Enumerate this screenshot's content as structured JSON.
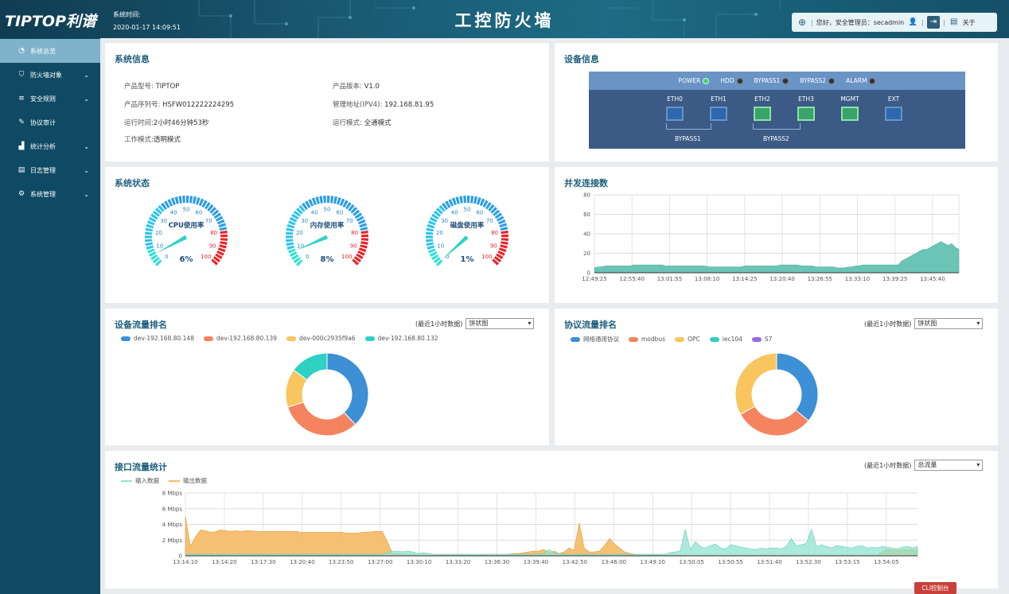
{
  "header": {
    "logo": "TIPTOP利谱",
    "systime_label": "系统时间:",
    "systime": "2020-01-17 14:09:51",
    "title": "工控防火墙",
    "greeting": "您好，安全管理员：secadmin",
    "about": "关于"
  },
  "sidebar": {
    "items": [
      {
        "label": "系统总览",
        "icon": "dashboard-icon",
        "active": true,
        "chevron": false
      },
      {
        "label": "防火墙对象",
        "icon": "shield-icon",
        "active": false,
        "chevron": true
      },
      {
        "label": "安全规则",
        "icon": "list-icon",
        "active": false,
        "chevron": true
      },
      {
        "label": "协议审计",
        "icon": "wrench-icon",
        "active": false,
        "chevron": false
      },
      {
        "label": "统计分析",
        "icon": "chart-icon",
        "active": false,
        "chevron": true
      },
      {
        "label": "日志管理",
        "icon": "book-icon",
        "active": false,
        "chevron": true
      },
      {
        "label": "系统管理",
        "icon": "gears-icon",
        "active": false,
        "chevron": true
      }
    ]
  },
  "system_info": {
    "title": "系统信息",
    "model_k": "产品型号:",
    "model_v": "TIPTOP",
    "version_k": "产品版本:",
    "version_v": "V1.0",
    "serial_k": "产品序列号:",
    "serial_v": "HSFW012222224295",
    "mgmt_k": "管理地址(IPV4):",
    "mgmt_v": "192.168.81.95",
    "uptime_k": "运行时间:",
    "uptime_v": "2小时46分钟53秒",
    "runmode_k": "运行模式:",
    "runmode_v": "全通模式",
    "workmode_k": "工作模式:",
    "workmode_v": "透明模式"
  },
  "device_info": {
    "title": "设备信息",
    "leds": [
      {
        "label": "POWER",
        "on": true
      },
      {
        "label": "HDD",
        "on": false
      },
      {
        "label": "BYPASS1",
        "on": false
      },
      {
        "label": "BYPASS2",
        "on": false
      },
      {
        "label": "ALARM",
        "on": false
      }
    ],
    "ports": [
      {
        "label": "ETH0",
        "up": false
      },
      {
        "label": "ETH1",
        "up": false
      },
      {
        "label": "ETH2",
        "up": true
      },
      {
        "label": "ETH3",
        "up": true
      },
      {
        "label": "MGMT",
        "up": true
      },
      {
        "label": "EXT",
        "up": false
      }
    ],
    "bypass1": "BYPASS1",
    "bypass2": "BYPASS2"
  },
  "system_status": {
    "title": "系统状态",
    "ticks": [
      "0",
      "10",
      "20",
      "30",
      "40",
      "50",
      "60",
      "70",
      "80",
      "90",
      "100"
    ],
    "gauges": [
      {
        "label": "CPU使用率",
        "value": 6,
        "text": "6%"
      },
      {
        "label": "内存使用率",
        "value": 8,
        "text": "8%"
      },
      {
        "label": "磁盘使用率",
        "value": 1,
        "text": "1%"
      }
    ]
  },
  "concurrent": {
    "title": "并发连接数",
    "chart_data": {
      "type": "area",
      "ylim": [
        0,
        80
      ],
      "yticks": [
        "0",
        "20",
        "40",
        "60",
        "80"
      ],
      "xticks": [
        "12:49:25",
        "12:55:40",
        "13:01:55",
        "13:08:10",
        "13:14:25",
        "13:20:40",
        "13:26:55",
        "13:33:10",
        "13:39:25",
        "13:45:40"
      ],
      "color": "#6cc4b6",
      "values": [
        5,
        6,
        6,
        7,
        7,
        7,
        7,
        7,
        7,
        7,
        7,
        8,
        8,
        8,
        8,
        8,
        8,
        8,
        8,
        8,
        7,
        7,
        7,
        7,
        7,
        7,
        7,
        7,
        7,
        7,
        7,
        7,
        6,
        6,
        6,
        6,
        6,
        6,
        6,
        6,
        6,
        6,
        7,
        7,
        7,
        7,
        7,
        7,
        7,
        7,
        7,
        7,
        8,
        8,
        8,
        8,
        8,
        8,
        7,
        7,
        7,
        7,
        6,
        6,
        6,
        6,
        6,
        6,
        5,
        5,
        5,
        6,
        6,
        7,
        7,
        8,
        8,
        8,
        8,
        8,
        8,
        8,
        8,
        8,
        8,
        8,
        12,
        14,
        16,
        18,
        20,
        22,
        24,
        24,
        26,
        28,
        30,
        32,
        30,
        28,
        30,
        26,
        24
      ]
    }
  },
  "device_traffic": {
    "title": "设备流量排名",
    "range": "(最近1小时数据)",
    "select": "饼状图",
    "chart_data": {
      "type": "pie",
      "series": [
        {
          "name": "dev-192.168.80.148",
          "value": 38,
          "color": "#3d8fd6"
        },
        {
          "name": "dev-192.168.80.139",
          "value": 32,
          "color": "#f4835f"
        },
        {
          "name": "dev-000c2935f9a6",
          "value": 15,
          "color": "#f8c55f"
        },
        {
          "name": "dev-192.168.80.132",
          "value": 15,
          "color": "#2fd1c3"
        }
      ]
    }
  },
  "protocol_traffic": {
    "title": "协议流量排名",
    "range": "(最近1小时数据)",
    "select": "饼状图",
    "chart_data": {
      "type": "pie",
      "series": [
        {
          "name": "网络通用协议",
          "value": 36,
          "color": "#3d8fd6"
        },
        {
          "name": "modbus",
          "value": 31,
          "color": "#f4835f"
        },
        {
          "name": "OPC",
          "value": 33,
          "color": "#f8c55f"
        },
        {
          "name": "iec104",
          "value": 0,
          "color": "#2fd1c3"
        },
        {
          "name": "S7",
          "value": 0,
          "color": "#9a6ae3"
        }
      ]
    }
  },
  "interface_traffic": {
    "title": "接口流量统计",
    "range": "(最近1小时数据)",
    "select": "总流量",
    "chart_data": {
      "type": "area",
      "ylim": [
        0,
        8
      ],
      "yticks": [
        "0",
        "2 Mbps",
        "4 Mbps",
        "6 Mbps",
        "8 Mbps"
      ],
      "xticks": [
        "13:14:10",
        "13:14:20",
        "13:17:30",
        "13:20:40",
        "13:23:50",
        "13:27:00",
        "13:30:10",
        "13:33:20",
        "13:36:30",
        "13:39:40",
        "13:42:50",
        "13:46:00",
        "13:49:10",
        "13:50:05",
        "13:50:55",
        "13:51:40",
        "13:52:30",
        "13:53:15",
        "13:54:05"
      ],
      "series": [
        {
          "name": "输入数据",
          "color": "#8fe3d0",
          "values": [
            0.2,
            0.2,
            0.2,
            0.2,
            0.2,
            0.2,
            0.2,
            0.2,
            0.2,
            0.2,
            0.2,
            0.2,
            0.2,
            0.2,
            0.2,
            0.2,
            0.2,
            0.2,
            0.2,
            0.2,
            0.2,
            0.2,
            0.2,
            0.2,
            0.2,
            0.2,
            0.2,
            0.2,
            0.2,
            0.2,
            0.2,
            0.2,
            0.2,
            0.2,
            0.2,
            0.2,
            0.2,
            0.2,
            0.2,
            0.2,
            0.4,
            0.6,
            0.6,
            0.5,
            0.6,
            0.5,
            0.3,
            0.4,
            0.3,
            0.2,
            0.2,
            0.2,
            0.2,
            0.2,
            0.2,
            0.2,
            0.2,
            0.2,
            0.2,
            0.2,
            0.2,
            0.2,
            0.2,
            0.2,
            0.2,
            0.2,
            0.2,
            0.2,
            0.2,
            0.2,
            0.2,
            0.3,
            0.8,
            0.4,
            0.3,
            0.2,
            0.2,
            0.2,
            0.2,
            0.2,
            0.2,
            0.2,
            0.2,
            0.2,
            0.2,
            0.2,
            0.2,
            0.2,
            0.2,
            0.2,
            0.2,
            0.2,
            0.2,
            0.2,
            0.2,
            0.2,
            0.4,
            0.5,
            0.6,
            3.4,
            0.8,
            1.8,
            1.2,
            1.0,
            1.3,
            1.5,
            1.0,
            0.9,
            1.4,
            1.3,
            1.1,
            1.0,
            0.9,
            0.8,
            1.0,
            0.9,
            1.0,
            1.0,
            0.9,
            1.2,
            2.2,
            1.3,
            1.4,
            1.6,
            3.4,
            1.2,
            1.4,
            1.2,
            1.0,
            1.3,
            1.2,
            1.1,
            1.0,
            1.2,
            1.3,
            1.0,
            1.1,
            1.0,
            1.2,
            1.1,
            1.0,
            0.9,
            1.1,
            1.2,
            1.0,
            1.2
          ]
        },
        {
          "name": "输出数据",
          "color": "#f5b964",
          "values": [
            5.0,
            1.2,
            2.4,
            3.3,
            3.2,
            3.0,
            3.1,
            3.3,
            3.2,
            3.1,
            3.2,
            3.1,
            3.2,
            3.2,
            3.1,
            3.1,
            3.1,
            3.1,
            3.1,
            3.1,
            3.1,
            3.1,
            3.1,
            3.0,
            3.0,
            3.0,
            3.0,
            3.0,
            3.0,
            3.0,
            3.0,
            3.0,
            2.9,
            2.9,
            2.9,
            3.0,
            3.0,
            3.1,
            3.1,
            3.1,
            1.8,
            0.3,
            0.3,
            0.2,
            0.2,
            0.2,
            0.1,
            0.1,
            0.1,
            0.1,
            0.1,
            0.1,
            0.1,
            0.1,
            0.1,
            0.1,
            0.1,
            0.1,
            0.1,
            0.1,
            0.1,
            0.1,
            0.1,
            0.1,
            0.2,
            0.3,
            0.3,
            0.4,
            0.5,
            0.6,
            0.6,
            0.8,
            0.4,
            0.6,
            0.3,
            0.5,
            1.0,
            0.7,
            4.2,
            1.0,
            0.5,
            0.5,
            0.6,
            1.3,
            2.2,
            1.5,
            1.0,
            0.5,
            0.3,
            0.2,
            0.1,
            0.1,
            0.1,
            0.1,
            0.1,
            0.1,
            0.1,
            0.1,
            0.1,
            0.1,
            0.1,
            0.1,
            0.1,
            0.1,
            0.1,
            0.1,
            0.1,
            0.1,
            0.1,
            0.1,
            0.1,
            0.1,
            0.1,
            0.1,
            0.1,
            0.1,
            0.1,
            0.1,
            0.1,
            0.1,
            0.1,
            0.1,
            0.1,
            0.1,
            0.1,
            0.1,
            0.1,
            0.1,
            0.1,
            0.1,
            0.1,
            0.1,
            0.1,
            0.1,
            0.1,
            0.1,
            0.1,
            0.1,
            0.5,
            0.8,
            0.8,
            0.7,
            0.8,
            0.8,
            0.8,
            0.8
          ]
        }
      ]
    }
  },
  "cli_button": "CLI控制台"
}
